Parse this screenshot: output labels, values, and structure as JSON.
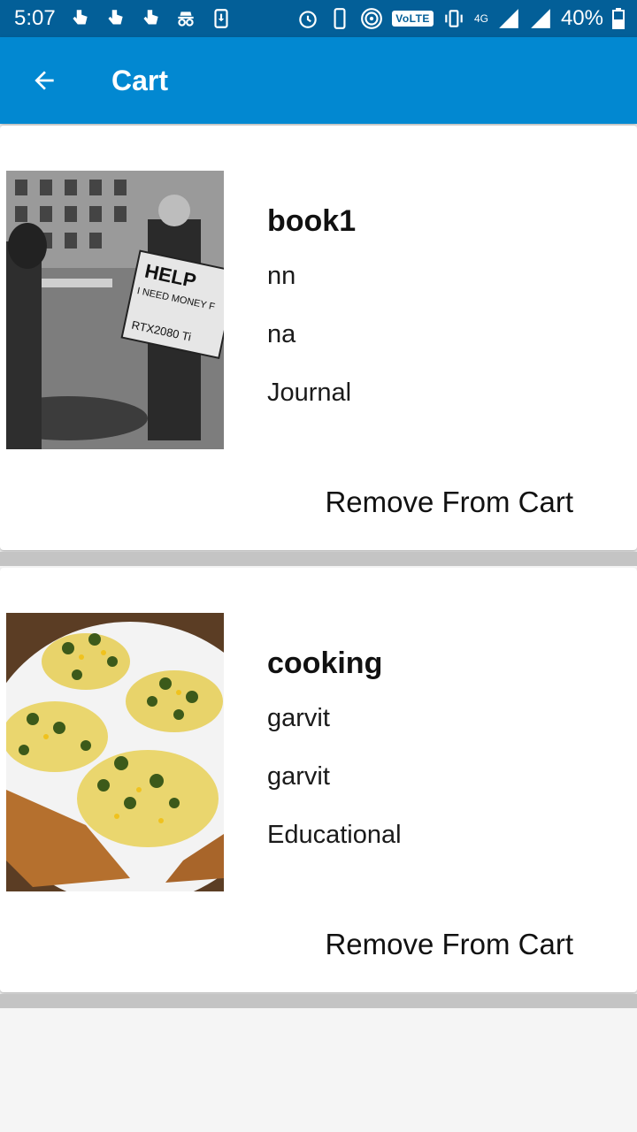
{
  "status_bar": {
    "time": "5:07",
    "volte": "VoLTE",
    "network": "4G",
    "battery": "40%"
  },
  "app_bar": {
    "title": "Cart",
    "back_icon": "arrow-back-icon"
  },
  "items": [
    {
      "title": "book1",
      "line1": "nn",
      "line2": "na",
      "category": "Journal",
      "image_sign_text": [
        "HELP",
        "I NEED MONEY F",
        "RTX2080 Ti"
      ],
      "remove_label": "Remove From Cart"
    },
    {
      "title": "cooking",
      "line1": "garvit",
      "line2": "garvit",
      "category": "Educational",
      "remove_label": "Remove From Cart"
    }
  ],
  "colors": {
    "status_bar": "#035f98",
    "app_bar": "#0288d1",
    "background": "#f5f5f5"
  }
}
